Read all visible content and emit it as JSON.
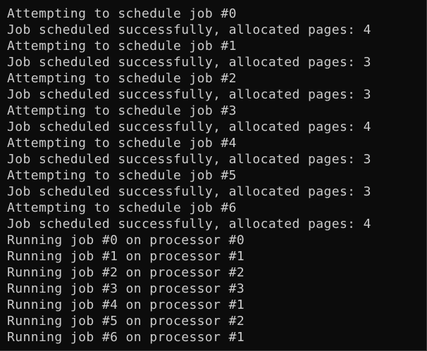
{
  "terminal": {
    "lines": [
      "Attempting to schedule job #0",
      "Job scheduled successfully, allocated pages: 4",
      "Attempting to schedule job #1",
      "Job scheduled successfully, allocated pages: 3",
      "Attempting to schedule job #2",
      "Job scheduled successfully, allocated pages: 3",
      "Attempting to schedule job #3",
      "Job scheduled successfully, allocated pages: 4",
      "Attempting to schedule job #4",
      "Job scheduled successfully, allocated pages: 3",
      "Attempting to schedule job #5",
      "Job scheduled successfully, allocated pages: 3",
      "Attempting to schedule job #6",
      "Job scheduled successfully, allocated pages: 4",
      "Running job #0 on processor #0",
      "Running job #1 on processor #1",
      "Running job #2 on processor #2",
      "Running job #3 on processor #3",
      "Running job #4 on processor #1",
      "Running job #5 on processor #2",
      "Running job #6 on processor #1"
    ],
    "colors": {
      "background": "#0c0c0c",
      "foreground": "#cccccc"
    }
  }
}
